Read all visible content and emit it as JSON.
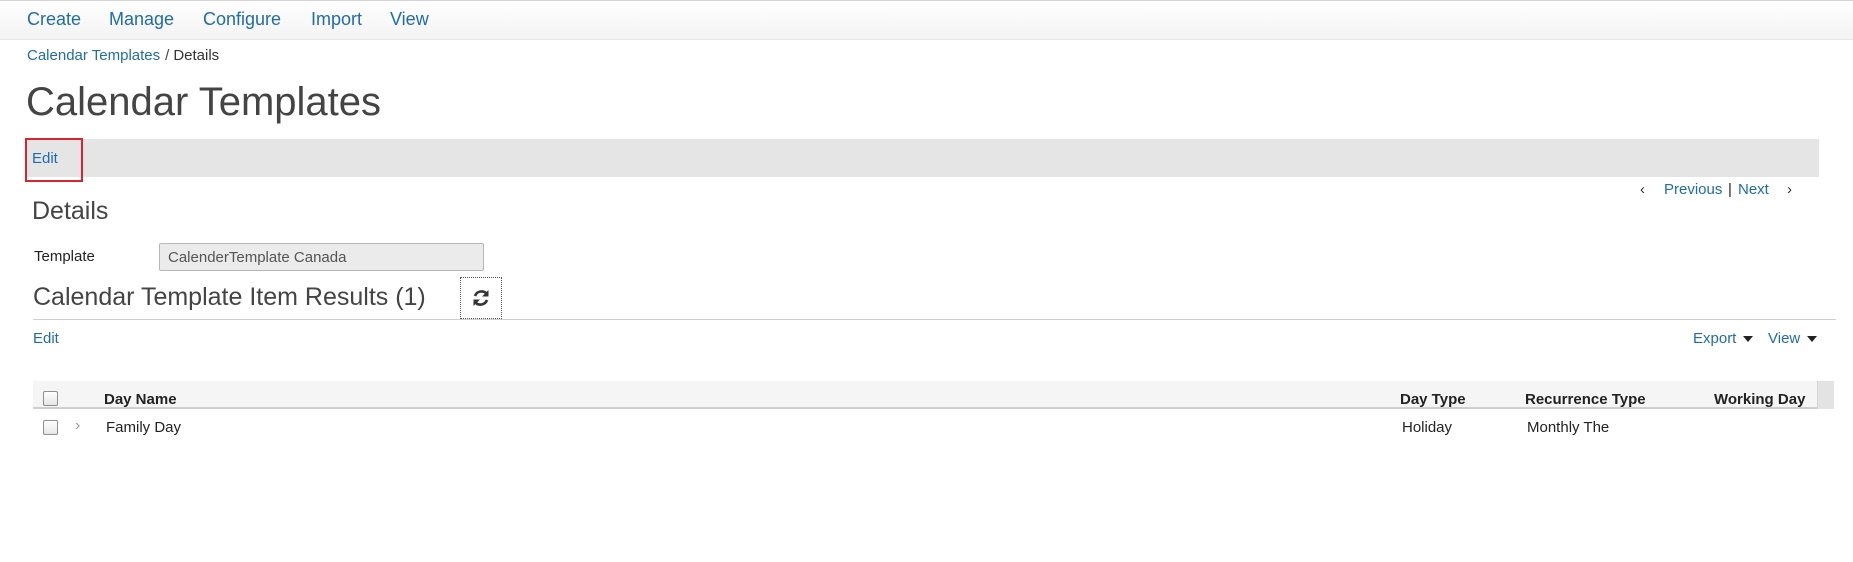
{
  "nav": {
    "items": [
      "Create",
      "Manage",
      "Configure",
      "Import",
      "View"
    ]
  },
  "breadcrumb": {
    "parent": "Calendar Templates",
    "separator": "/",
    "current": "Details"
  },
  "page": {
    "title": "Calendar Templates"
  },
  "actionbar": {
    "edit_label": "Edit"
  },
  "pager": {
    "previous_label": "Previous",
    "separator": "|",
    "next_label": "Next"
  },
  "details": {
    "title": "Details",
    "template_label": "Template",
    "template_value": "CalenderTemplate Canada"
  },
  "results": {
    "title": "Calendar Template Item Results (1)",
    "edit_label": "Edit",
    "export_label": "Export",
    "view_label": "View"
  },
  "grid": {
    "columns": [
      "Day Name",
      "Day Type",
      "Recurrence Type",
      "Working Day"
    ],
    "rows": [
      {
        "day_name": "Family Day",
        "day_type": "Holiday",
        "recurrence_type": "Monthly The",
        "working_day": ""
      }
    ]
  },
  "colors": {
    "link": "#1f6bb0",
    "highlight_border": "#d9232e",
    "actionbar_bg": "#e5e5e5"
  },
  "icons": {
    "previous": "chevron-left-icon",
    "next": "chevron-right-icon",
    "refresh": "refresh-icon",
    "expand": "chevron-right-icon",
    "dropdown": "caret-down-icon"
  }
}
